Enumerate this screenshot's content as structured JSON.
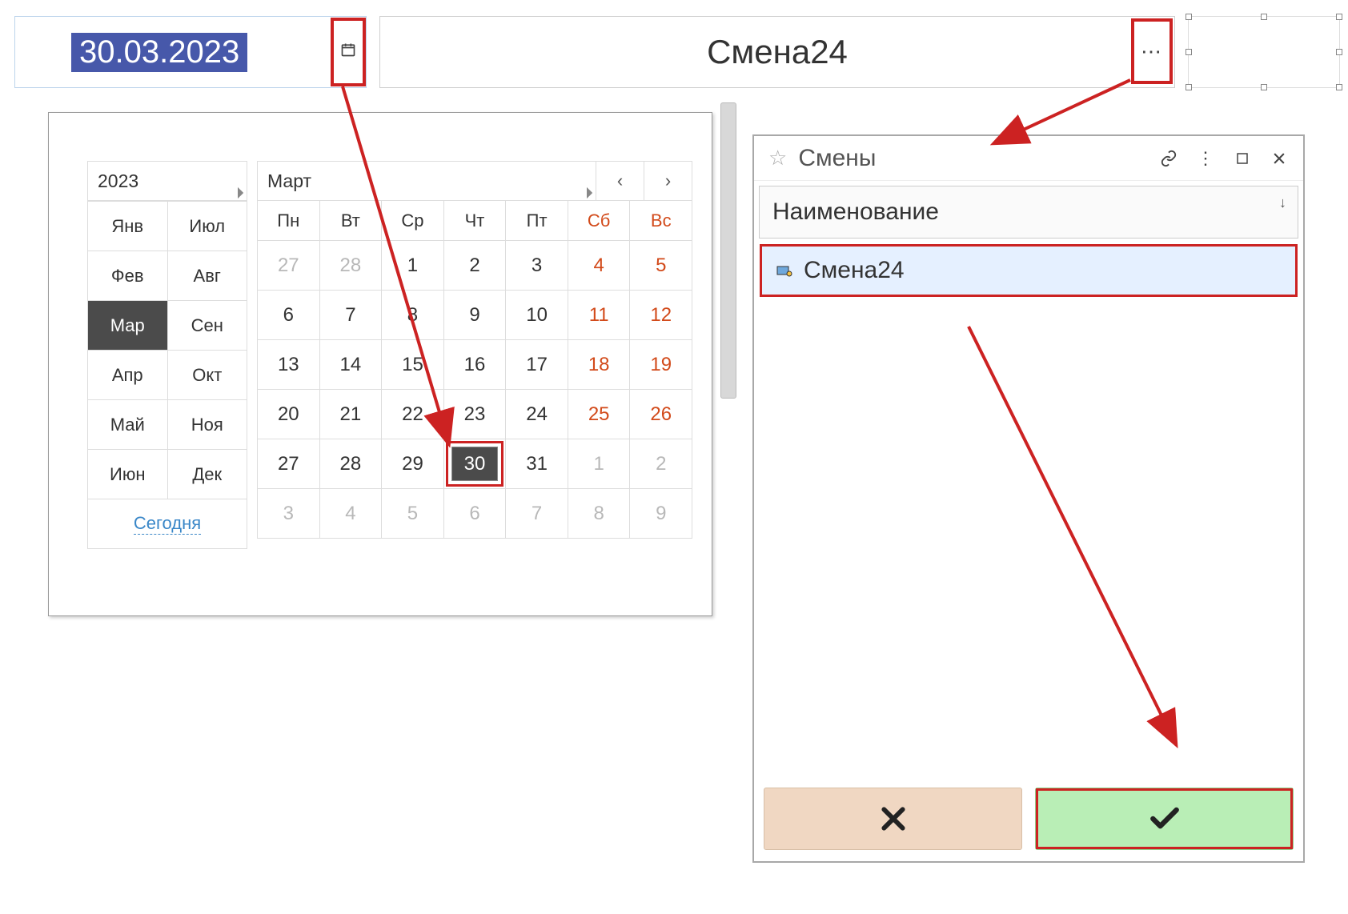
{
  "date_input": {
    "value": "30.03.2023"
  },
  "shift_input": {
    "value": "Смена24"
  },
  "calendar": {
    "year": "2023",
    "month_name": "Март",
    "months": [
      "Янв",
      "Фев",
      "Мар",
      "Апр",
      "Май",
      "Июн",
      "Июл",
      "Авг",
      "Сен",
      "Окт",
      "Ноя",
      "Дек"
    ],
    "selected_month_index": 2,
    "dow": [
      "Пн",
      "Вт",
      "Ср",
      "Чт",
      "Пт",
      "Сб",
      "Вс"
    ],
    "today_label": "Сегодня",
    "selected_day": 30,
    "weeks": [
      [
        {
          "d": 27,
          "o": true
        },
        {
          "d": 28,
          "o": true
        },
        {
          "d": 1
        },
        {
          "d": 2
        },
        {
          "d": 3
        },
        {
          "d": 4,
          "w": true
        },
        {
          "d": 5,
          "w": true
        }
      ],
      [
        {
          "d": 6
        },
        {
          "d": 7
        },
        {
          "d": 8
        },
        {
          "d": 9
        },
        {
          "d": 10
        },
        {
          "d": 11,
          "w": true
        },
        {
          "d": 12,
          "w": true
        }
      ],
      [
        {
          "d": 13
        },
        {
          "d": 14
        },
        {
          "d": 15
        },
        {
          "d": 16
        },
        {
          "d": 17
        },
        {
          "d": 18,
          "w": true
        },
        {
          "d": 19,
          "w": true
        }
      ],
      [
        {
          "d": 20
        },
        {
          "d": 21
        },
        {
          "d": 22
        },
        {
          "d": 23
        },
        {
          "d": 24
        },
        {
          "d": 25,
          "w": true
        },
        {
          "d": 26,
          "w": true
        }
      ],
      [
        {
          "d": 27
        },
        {
          "d": 28
        },
        {
          "d": 29
        },
        {
          "d": 30,
          "sel": true
        },
        {
          "d": 31
        },
        {
          "d": 1,
          "o": true
        },
        {
          "d": 2,
          "o": true
        }
      ],
      [
        {
          "d": 3,
          "o": true
        },
        {
          "d": 4,
          "o": true
        },
        {
          "d": 5,
          "o": true
        },
        {
          "d": 6,
          "o": true
        },
        {
          "d": 7,
          "o": true
        },
        {
          "d": 8,
          "o": true
        },
        {
          "d": 9,
          "o": true
        }
      ]
    ]
  },
  "dialog": {
    "title": "Смены",
    "column_header": "Наименование",
    "rows": [
      "Смена24"
    ]
  }
}
